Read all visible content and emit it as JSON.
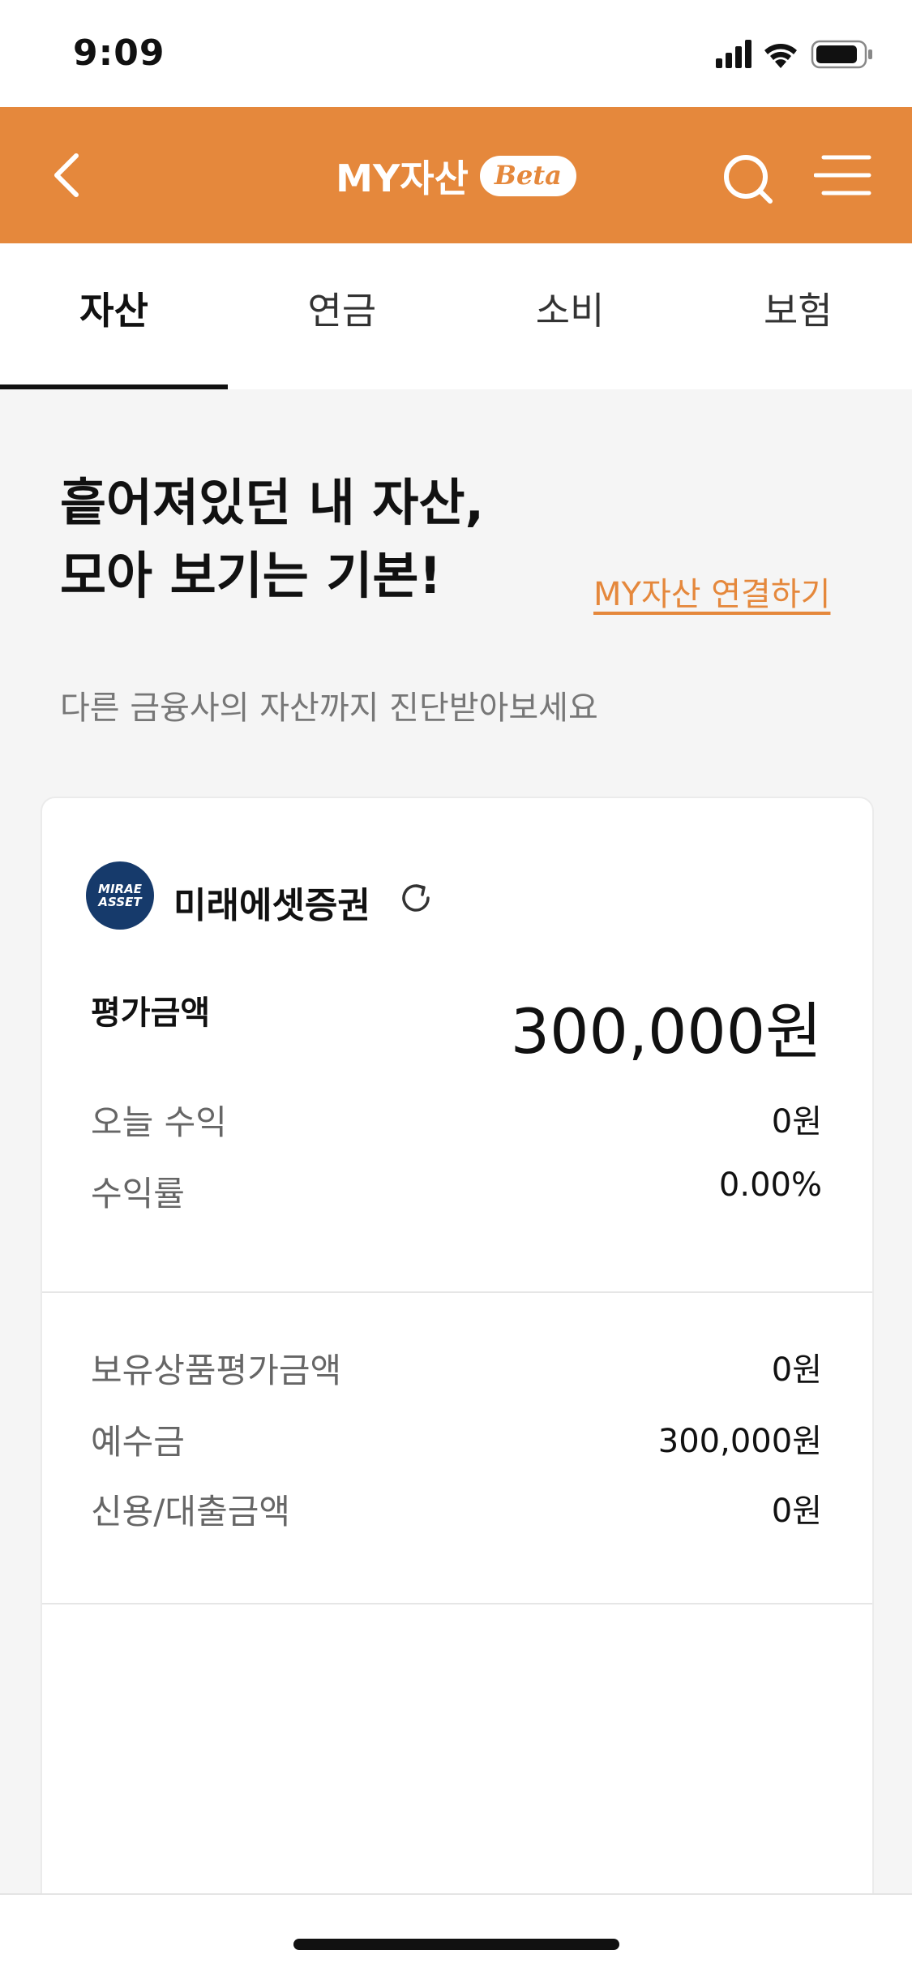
{
  "status_bar": {
    "time": "9:09"
  },
  "header": {
    "title": "MY자산",
    "badge": "Beta"
  },
  "tabs": [
    {
      "label": "자산",
      "active": true
    },
    {
      "label": "연금",
      "active": false
    },
    {
      "label": "소비",
      "active": false
    },
    {
      "label": "보험",
      "active": false
    }
  ],
  "promo": {
    "headline_line1": "흩어져있던 내 자산,",
    "headline_line2": "모아 보기는 기본!",
    "connect_link": "MY자산 연결하기",
    "subtext": "다른 금융사의 자산까지 진단받아보세요"
  },
  "card": {
    "logo_line1": "MIRAE",
    "logo_line2": "ASSET",
    "broker_name": "미래에셋증권",
    "eval_label": "평가금액",
    "eval_value": "300,000원",
    "summary_rows": [
      {
        "label": "오늘 수익",
        "value": "0원"
      },
      {
        "label": "수익률",
        "value": "0.00%"
      }
    ],
    "detail_rows": [
      {
        "label": "보유상품평가금액",
        "value": "0원"
      },
      {
        "label": "예수금",
        "value": "300,000원"
      },
      {
        "label": "신용/대출금액",
        "value": "0원"
      }
    ]
  },
  "colors": {
    "accent": "#e5883c",
    "logo_bg": "#163a6b"
  },
  "icons": [
    "back-icon",
    "search-icon",
    "menu-icon",
    "refresh-icon",
    "signal-icon",
    "wifi-icon",
    "battery-icon"
  ]
}
